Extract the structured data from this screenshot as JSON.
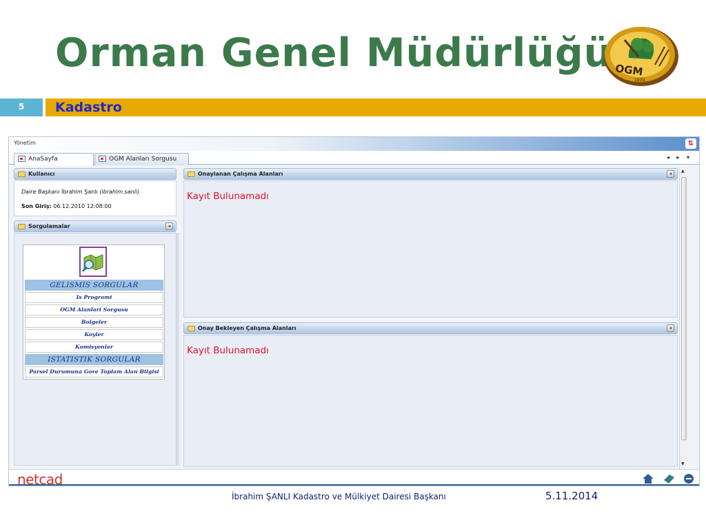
{
  "slide": {
    "title": "Orman Genel Müdürlüğü",
    "number": "5",
    "section": "Kadastro",
    "author": "İbrahim ŞANLI Kadastro ve Mülkiyet Dairesi Başkanı",
    "date": "5.11.2014"
  },
  "logo": {
    "text": "OGM",
    "year": "1839",
    "icon": "ogm-emblem-icon"
  },
  "app": {
    "title": "Yönetim",
    "tabs": [
      {
        "label": "AnaSayfa",
        "active": true
      },
      {
        "label": "OGM Alanları Sorgusu",
        "active": false
      }
    ],
    "nav_glyphs": "◂ ▸ ▾",
    "brand": "netcad"
  },
  "user_panel": {
    "title": "Kullanıcı",
    "role": "Daire Başkanı",
    "name": "İbrahim Şanlı",
    "username": "(ibrahim.sanli)",
    "login_label": "Son Giriş:",
    "login_time": "06.12.2010 12:08:00"
  },
  "query_panel": {
    "title": "Sorgulamalar",
    "sections": [
      {
        "heading": "GELISMIS SORGULAR",
        "items": [
          "Is Programi",
          "OGM Alanlari Sorgusu",
          "Bolgeler",
          "Koyler",
          "Komisyonlar"
        ]
      },
      {
        "heading": "ISTATISTIK SORGULAR",
        "items": [
          "Parsel Durumuna Gore Toplam Alan Bilgisi"
        ]
      }
    ]
  },
  "approved_panel": {
    "title": "Onaylanan Çalışma Alanları",
    "empty_message": "Kayıt Bulunamadı"
  },
  "pending_panel": {
    "title": "Onay Bekleyen Çalışma Alanları",
    "empty_message": "Kayıt Bulunamadı"
  },
  "colors": {
    "title_green": "#3c7a4c",
    "section_bar": "#e8aa00",
    "section_text": "#1d2ad0",
    "slide_number_bg": "#5bb5d3",
    "empty_message": "#e4122a",
    "netcad_red": "#c9372c"
  }
}
